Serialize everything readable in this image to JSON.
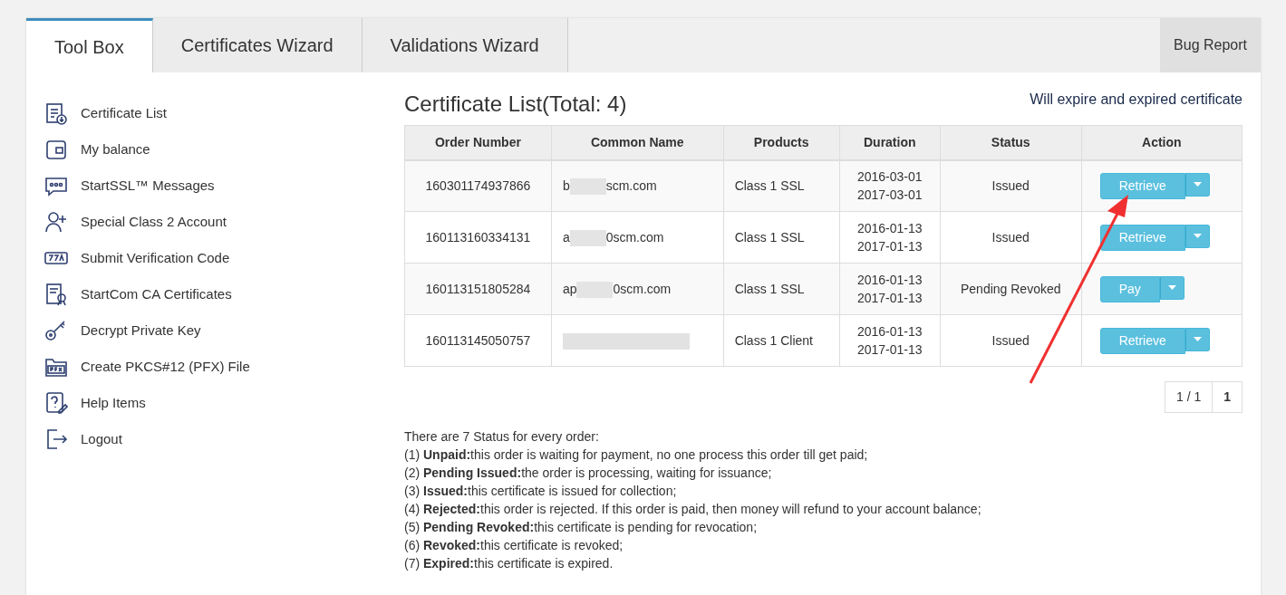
{
  "tabs": [
    {
      "label": "Tool Box",
      "selected": true
    },
    {
      "label": "Certificates Wizard",
      "selected": false
    },
    {
      "label": "Validations Wizard",
      "selected": false
    }
  ],
  "bug_report": "Bug Report",
  "sidebar": {
    "items": [
      {
        "label": "Certificate List",
        "kind": "cert-list"
      },
      {
        "label": "My balance",
        "kind": "wallet"
      },
      {
        "label": "StartSSL™ Messages",
        "kind": "chat"
      },
      {
        "label": "Special Class 2 Account",
        "kind": "user-plus"
      },
      {
        "label": "Submit Verification Code",
        "kind": "code"
      },
      {
        "label": "StartCom CA Certificates",
        "kind": "certificate"
      },
      {
        "label": "Decrypt Private Key",
        "kind": "key"
      },
      {
        "label": "Create PKCS#12 (PFX) File",
        "kind": "pfx"
      },
      {
        "label": "Help Items",
        "kind": "help"
      },
      {
        "label": "Logout",
        "kind": "logout"
      }
    ]
  },
  "heading": "Certificate List(Total: 4)",
  "expire_link": "Will expire and expired certificate",
  "table": {
    "columns": [
      "Order Number",
      "Common Name",
      "Products",
      "Duration",
      "Status",
      "Action"
    ],
    "rows": [
      {
        "order": "160301174937866",
        "name_start": "b",
        "name_end": "scm.com",
        "product": "Class 1 SSL",
        "from": "2016-03-01",
        "to": "2017-03-01",
        "status": "Issued",
        "action": "Retrieve"
      },
      {
        "order": "160113160334131",
        "name_start": "a",
        "name_end": "0scm.com",
        "product": "Class 1 SSL",
        "from": "2016-01-13",
        "to": "2017-01-13",
        "status": "Issued",
        "action": "Retrieve"
      },
      {
        "order": "160113151805284",
        "name_start": "ap",
        "name_end": "0scm.com",
        "product": "Class 1 SSL",
        "from": "2016-01-13",
        "to": "2017-01-13",
        "status": "Pending Revoked",
        "action": "Pay"
      },
      {
        "order": "160113145050757",
        "product": "Class 1 Client",
        "from": "2016-01-13",
        "to": "2017-01-13",
        "status": "Issued",
        "action": "Retrieve"
      }
    ]
  },
  "pagination": {
    "info": "1 / 1",
    "pages": [
      {
        "label": "1",
        "selected": true
      }
    ]
  },
  "notes": [
    "There are 7 Status for every order:",
    "(1) **Unpaid:**this order is waiting for payment, no one process this order till get paid;",
    "(2) **Pending Issued:**the order is processing, waiting for issuance;",
    "(3) **Issued:**this certificate is issued for collection;",
    "(4) **Rejected:**this order is rejected. If this order is paid, then money will refund to your account balance;",
    "(5) **Pending Revoked:**this certificate is pending for revocation;",
    "(6) **Revoked:**this certificate is revoked;",
    "(7) **Expired:**this certificate is expired."
  ]
}
